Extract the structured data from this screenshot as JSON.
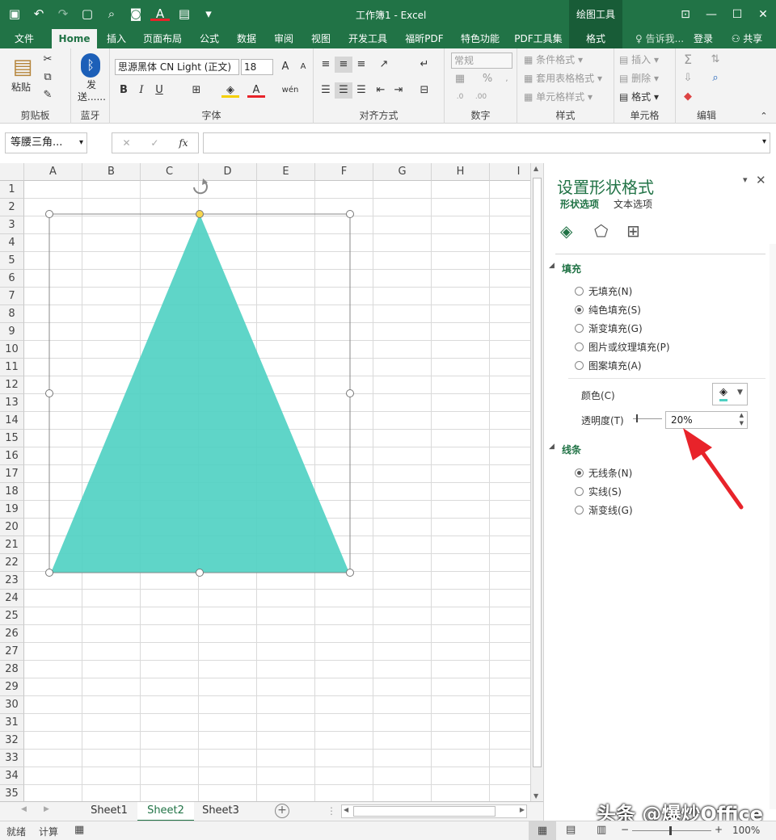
{
  "window": {
    "title": "工作簿1 - Excel",
    "drawing_tools": "绘图工具"
  },
  "ribbon_tabs": [
    "文件",
    "Home",
    "插入",
    "页面布局",
    "公式",
    "数据",
    "审阅",
    "视图",
    "开发工具",
    "福昕PDF",
    "特色功能",
    "PDF工具集",
    "格式"
  ],
  "tell_me": "告诉我...",
  "sign_in": "登录",
  "share": "共享",
  "clipboard": {
    "paste": "粘贴",
    "label": "剪贴板"
  },
  "bluetooth": {
    "send": "发送......",
    "label": "蓝牙"
  },
  "font": {
    "name": "思源黑体 CN Light (正文)",
    "size": "18",
    "bold": "B",
    "italic": "I",
    "underline": "U",
    "label": "字体"
  },
  "alignment": {
    "label": "对齐方式"
  },
  "number": {
    "format": "常规",
    "label": "数字"
  },
  "styles": {
    "conditional": "条件格式",
    "table": "套用表格格式",
    "cell": "单元格样式",
    "label": "样式"
  },
  "cells": {
    "insert": "插入",
    "delete": "删除",
    "format": "格式",
    "label": "单元格"
  },
  "editing": {
    "label": "编辑"
  },
  "formula_bar": {
    "name_box": "等腰三角...",
    "fx": "fx",
    "cancel": "✕",
    "confirm": "✓"
  },
  "columns": [
    "A",
    "B",
    "C",
    "D",
    "E",
    "F",
    "G",
    "H",
    "I"
  ],
  "rows": [
    "1",
    "2",
    "3",
    "4",
    "5",
    "6",
    "7",
    "8",
    "9",
    "10",
    "11",
    "12",
    "13",
    "14",
    "15",
    "16",
    "17",
    "18",
    "19",
    "20",
    "21",
    "22",
    "23",
    "24",
    "25",
    "26",
    "27",
    "28",
    "29",
    "30",
    "31",
    "32",
    "33",
    "34",
    "35"
  ],
  "sheets": [
    "Sheet1",
    "Sheet2",
    "Sheet3"
  ],
  "active_sheet": "Sheet2",
  "status": {
    "ready": "就绪",
    "calc": "计算",
    "zoom": "100%"
  },
  "pane": {
    "title": "设置形状格式",
    "tabs": [
      "形状选项",
      "文本选项"
    ],
    "fill_section": "填充",
    "fill_options": [
      "无填充(N)",
      "纯色填充(S)",
      "渐变填充(G)",
      "图片或纹理填充(P)",
      "图案填充(A)"
    ],
    "fill_selected": "纯色填充(S)",
    "color_label": "颜色(C)",
    "transparency_label": "透明度(T)",
    "transparency_value": "20%",
    "line_section": "线条",
    "line_options": [
      "无线条(N)",
      "实线(S)",
      "渐变线(G)"
    ],
    "line_selected": "无线条(N)"
  },
  "shape": {
    "fill_color": "#4ed0c2",
    "outline_color": "#8a8a8a"
  },
  "colors": {
    "excel_green": "#217346",
    "dark_green": "#185c37",
    "arrow_red": "#e8232a"
  },
  "watermark": "头条 @爆炒Office"
}
